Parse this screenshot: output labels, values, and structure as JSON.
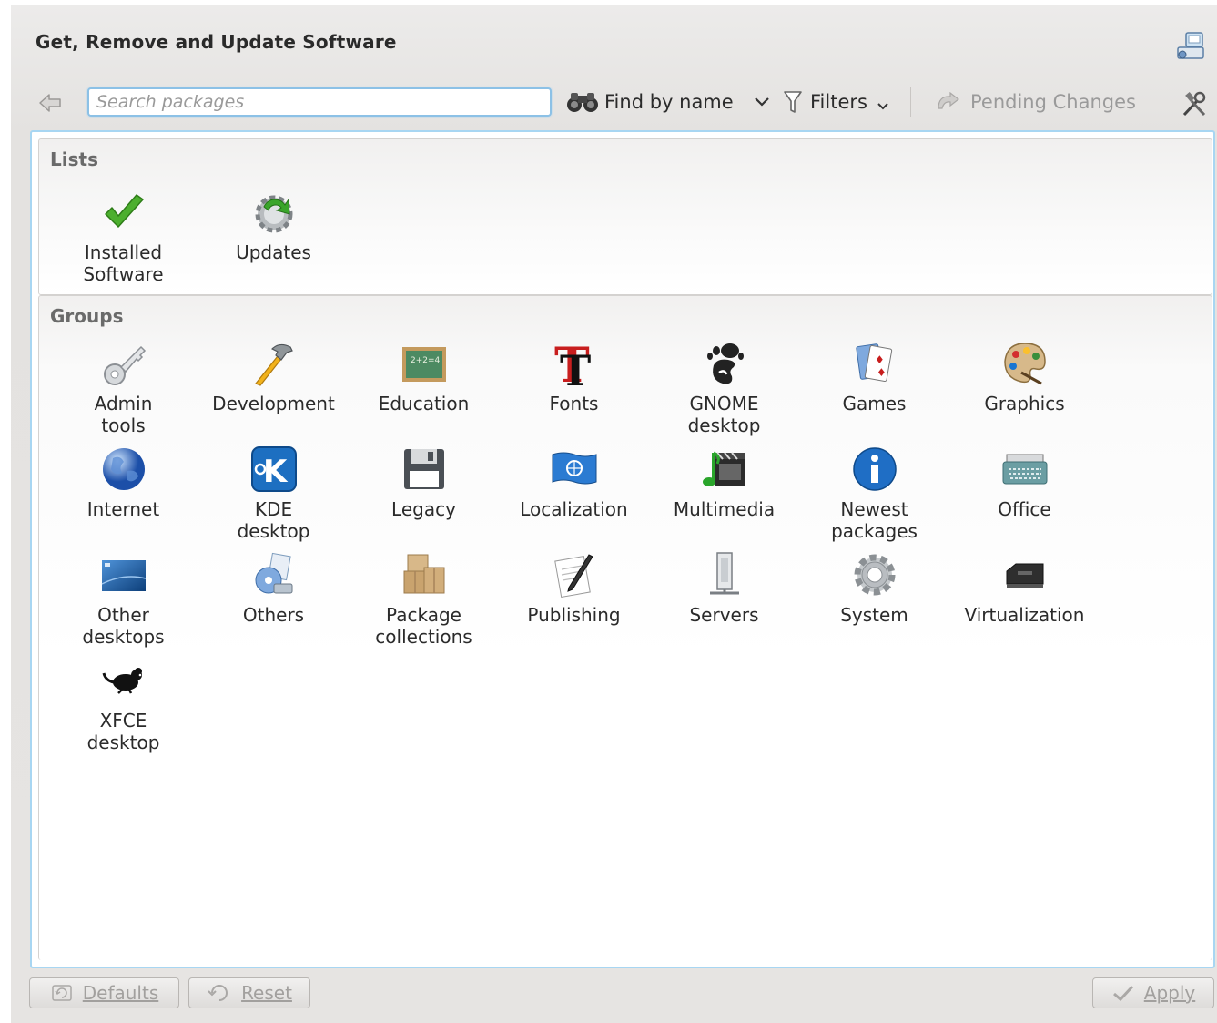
{
  "window": {
    "title": "Get, Remove and Update Software"
  },
  "toolbar": {
    "search_placeholder": "Search packages",
    "find_label": "Find by name",
    "filters_label": "Filters",
    "pending_label": "Pending Changes"
  },
  "lists": {
    "title": "Lists",
    "items": [
      {
        "label": "Installed\nSoftware",
        "icon": "checkmark-icon"
      },
      {
        "label": "Updates",
        "icon": "update-gear-icon"
      }
    ]
  },
  "groups": {
    "title": "Groups",
    "items": [
      {
        "label": "Admin\ntools",
        "icon": "key-icon"
      },
      {
        "label": "Development",
        "icon": "hammer-icon"
      },
      {
        "label": "Education",
        "icon": "chalkboard-icon"
      },
      {
        "label": "Fonts",
        "icon": "font-icon"
      },
      {
        "label": "GNOME\ndesktop",
        "icon": "gnome-foot-icon"
      },
      {
        "label": "Games",
        "icon": "cards-icon"
      },
      {
        "label": "Graphics",
        "icon": "palette-icon"
      },
      {
        "label": "Internet",
        "icon": "globe-icon"
      },
      {
        "label": "KDE\ndesktop",
        "icon": "kde-icon"
      },
      {
        "label": "Legacy",
        "icon": "floppy-icon"
      },
      {
        "label": "Localization",
        "icon": "un-flag-icon"
      },
      {
        "label": "Multimedia",
        "icon": "multimedia-icon"
      },
      {
        "label": "Newest\npackages",
        "icon": "info-icon"
      },
      {
        "label": "Office",
        "icon": "typewriter-icon"
      },
      {
        "label": "Other\ndesktops",
        "icon": "desktop-icon"
      },
      {
        "label": "Others",
        "icon": "others-icon"
      },
      {
        "label": "Package\ncollections",
        "icon": "boxes-icon"
      },
      {
        "label": "Publishing",
        "icon": "pen-paper-icon"
      },
      {
        "label": "Servers",
        "icon": "server-icon"
      },
      {
        "label": "System",
        "icon": "gear-icon"
      },
      {
        "label": "Virtualization",
        "icon": "chip-icon"
      },
      {
        "label": "XFCE\ndesktop",
        "icon": "mouse-icon"
      }
    ]
  },
  "buttons": {
    "defaults": "Defaults",
    "reset": "Reset",
    "apply": "Apply"
  },
  "colors": {
    "accent_border": "#a8d6f2",
    "window_bg": "#e6e4e2"
  }
}
